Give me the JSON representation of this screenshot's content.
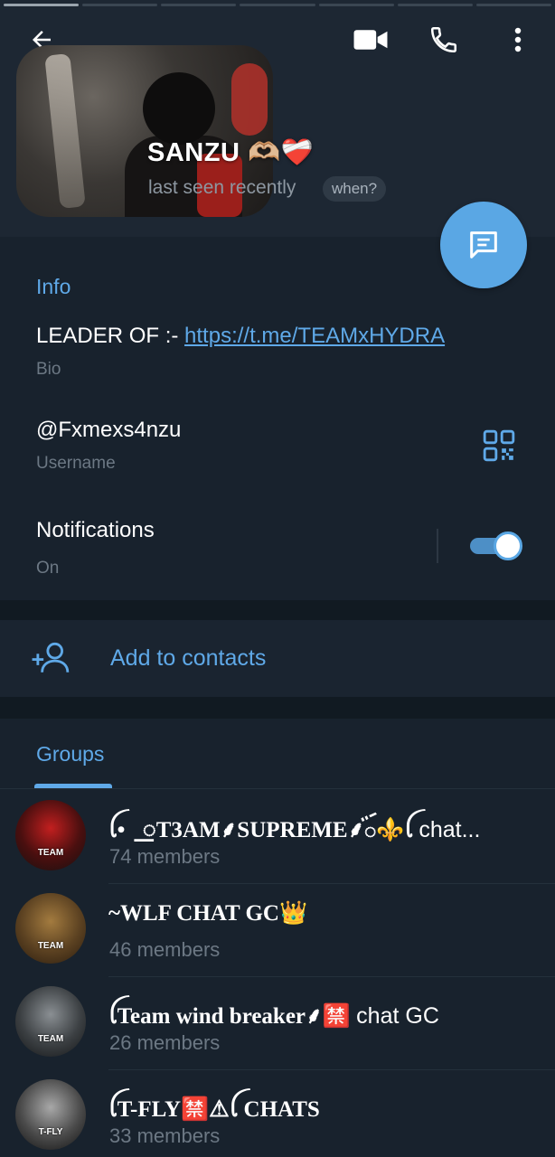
{
  "header": {
    "profile_name": "SANZU 🫶🏼❤️‍🩹",
    "last_seen": "last seen recently",
    "when_chip": "when?"
  },
  "info": {
    "section_title": "Info",
    "bio_prefix": "LEADER OF :- ",
    "bio_link": "https://t.me/TEAMxHYDRA",
    "bio_label": "Bio",
    "username": "@Fxmexs4nzu",
    "username_label": "Username",
    "notifications_label": "Notifications",
    "notifications_state": "On"
  },
  "actions": {
    "add_to_contacts": "Add to contacts"
  },
  "groups": {
    "tab_label": "Groups",
    "items": [
      {
        "name": "ꪶ•⃝꯭T3AM⸙SUPREME⸙ꪾ⚜️ꪶ ",
        "name_suffix": "chat...",
        "members": "74 members",
        "avatar_label": "TEAM"
      },
      {
        "name": "~WLF CHAT GC👑",
        "name_suffix": "",
        "members": "46 members",
        "avatar_label": "TEAM"
      },
      {
        "name": "ꪶTeam wind breaker⸙🈲 ",
        "name_suffix": "chat GC",
        "members": "26 members",
        "avatar_label": "TEAM"
      },
      {
        "name": "ꪶT-FLY🈲⚠ꪶ CHATS",
        "name_suffix": "",
        "members": "33 members",
        "avatar_label": "T-FLY"
      }
    ]
  },
  "colors": {
    "accent": "#5fa9e8",
    "fab": "#5aa7e4",
    "background": "#18222d"
  },
  "icons": {
    "back": "arrow-left-icon",
    "video": "video-camera-icon",
    "call": "phone-icon",
    "more": "more-vertical-icon",
    "fab": "message-icon",
    "qr": "qr-code-icon",
    "add_contact": "add-person-icon"
  }
}
